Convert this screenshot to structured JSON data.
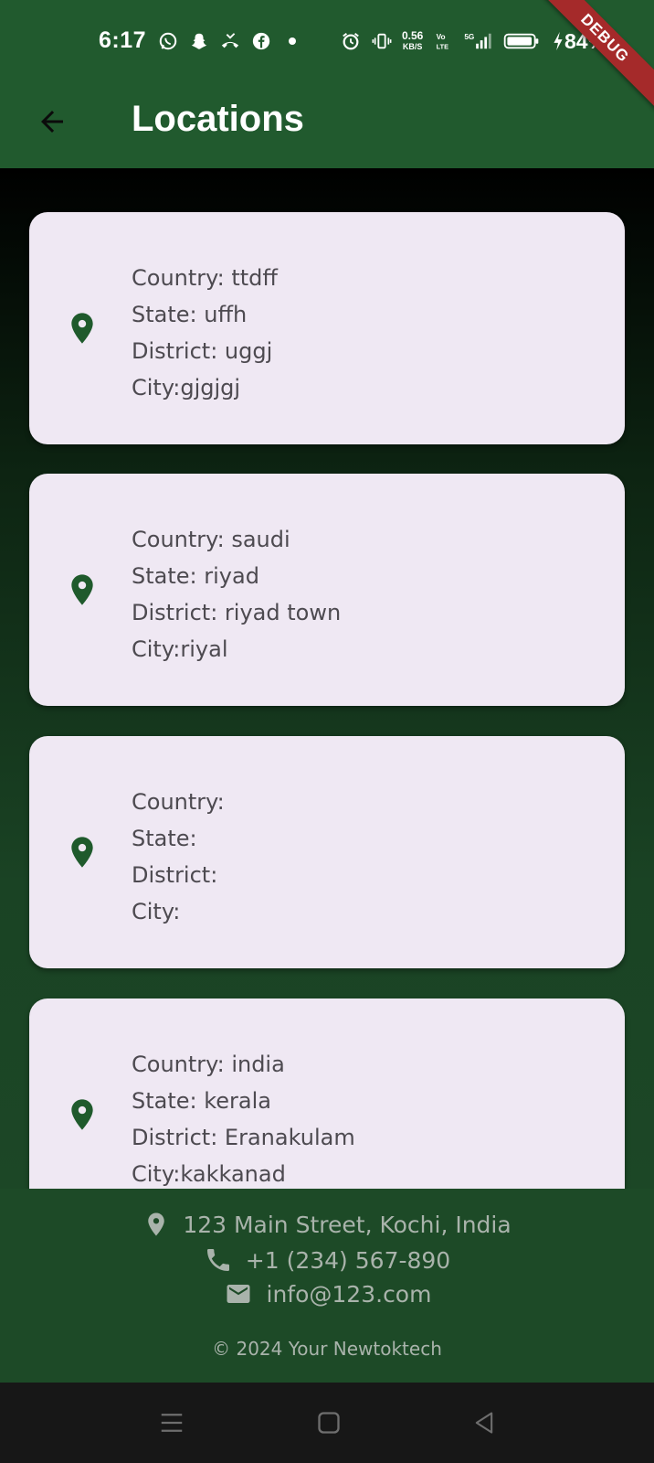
{
  "status_bar": {
    "time": "6:17",
    "net_speed_value": "0.56",
    "net_speed_unit": "KB/S",
    "network": "5G",
    "battery": "84%",
    "notification_icons": [
      "whatsapp-icon",
      "snapchat-icon",
      "missed-call-icon",
      "facebook-icon",
      "dot-icon"
    ],
    "system_icons": [
      "alarm-icon",
      "vibrate-icon",
      "volte-icon",
      "signal-icon",
      "battery-icon",
      "charging-icon"
    ]
  },
  "debug_banner": "DEBUG",
  "app_bar": {
    "title": "Locations",
    "back_icon": "arrow-back-icon"
  },
  "locations": [
    {
      "country": "Country: ttdff",
      "state": "State: uffh",
      "district": "District: uggj",
      "city": "City:gjgjgj"
    },
    {
      "country": "Country: saudi",
      "state": "State: riyad",
      "district": "District: riyad town",
      "city": "City:riyal"
    },
    {
      "country": "Country:",
      "state": "State:",
      "district": "District:",
      "city": "City:"
    },
    {
      "country": "Country: india",
      "state": "State: kerala",
      "district": "District: Eranakulam",
      "city": "City:kakkanad"
    }
  ],
  "footer": {
    "address": "123 Main Street, Kochi, India",
    "phone": "+1 (234) 567-890",
    "email": "info@123.com",
    "copyright": "© 2024 Your Newtoktech"
  },
  "colors": {
    "primary": "#215a2e",
    "card_bg": "#efe8f3",
    "icon": "#1f5a2c",
    "card_text": "#4d4a50",
    "footer_text": "#a9b3ab",
    "debug": "#a52a2a"
  },
  "nav": [
    "menu-icon",
    "home-square-icon",
    "back-triangle-icon"
  ]
}
